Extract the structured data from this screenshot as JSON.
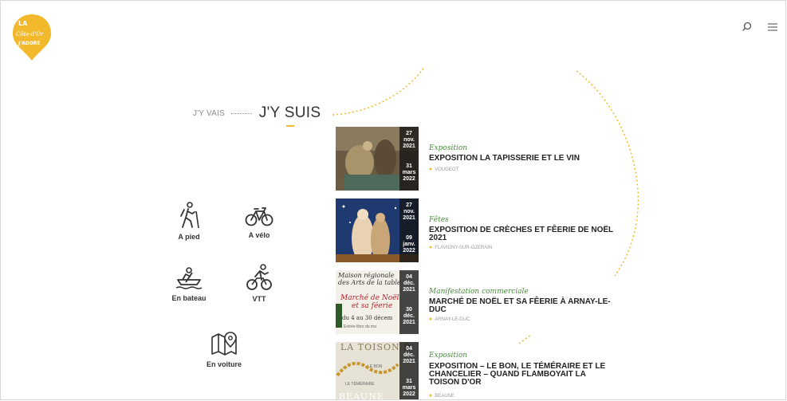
{
  "brand": {
    "logo_lines": [
      "LA",
      "Côte-d'Or",
      "J'ADORE"
    ],
    "accent": "#f2b92c"
  },
  "header": {
    "search_icon": "search-icon",
    "menu_icon": "hamburger-icon"
  },
  "tabs": {
    "inactive": "J'Y VAIS",
    "active": "J'Y SUIS"
  },
  "modes": [
    {
      "label": "A pied",
      "icon": "hiker-icon"
    },
    {
      "label": "A vélo",
      "icon": "bicycle-icon"
    },
    {
      "label": "En bateau",
      "icon": "boat-icon"
    },
    {
      "label": "VTT",
      "icon": "mountain-bike-icon"
    },
    {
      "label": "En voiture",
      "icon": "map-pin-icon"
    }
  ],
  "events": [
    {
      "category": "Exposition",
      "title": "EXPOSITION LA TAPISSERIE ET LE VIN",
      "location": "VOUGEOT",
      "start": [
        "27",
        "nov.",
        "2021"
      ],
      "end": [
        "31",
        "mars",
        "2022"
      ]
    },
    {
      "category": "Fêtes",
      "title": "EXPOSITION DE CRÈCHES ET FÊERIE DE NOËL 2021",
      "location": "FLAVIGNY-SUR-OZERAIN",
      "start": [
        "27",
        "nov.",
        "2021"
      ],
      "end": [
        "09",
        "janv.",
        "2022"
      ]
    },
    {
      "category": "Manifestation commerciale",
      "title": "MARCHÉ DE NOËL ET SA FÊERIE À ARNAY-LE-DUC",
      "location": "ARNAY-LE-DUC",
      "start": [
        "04",
        "déc.",
        "2021"
      ],
      "end": [
        "30",
        "déc.",
        "2021"
      ],
      "thumb_text": [
        "Maison régionale",
        "des Arts de la table",
        "Marché de Noël",
        "et sa féerie",
        "du 4 au 30 décem",
        "Entrée libre du ma"
      ]
    },
    {
      "category": "Exposition",
      "title": "EXPOSITION – LE BON, LE TÉMÉRAIRE ET LE CHANCELIER – QUAND FLAMBOYAIT LA TOISON D'OR",
      "location": "BEAUNE",
      "start": [
        "04",
        "déc.",
        "2021"
      ],
      "end": [
        "31",
        "mars",
        "2022"
      ],
      "thumb_text": [
        "LA TOISON D'",
        "LE BON",
        "LE TÉMÉRAIRE",
        "BEAUNE"
      ]
    }
  ]
}
